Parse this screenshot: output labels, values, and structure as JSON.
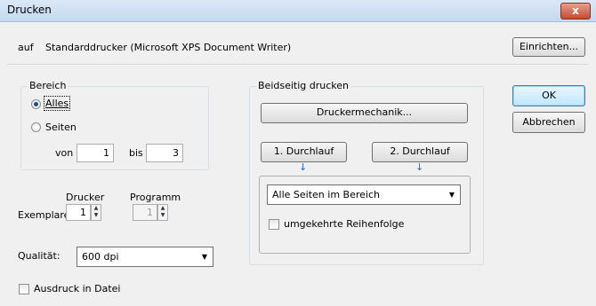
{
  "window": {
    "title": "Drucken",
    "close_glyph": "x"
  },
  "printer": {
    "prefix": "auf",
    "name": "Standarddrucker (Microsoft XPS Document Writer)",
    "setup_button": "Einrichten..."
  },
  "buttons": {
    "ok": "OK",
    "cancel": "Abbrechen"
  },
  "range": {
    "legend": "Bereich",
    "all_label": "Alles",
    "pages_label": "Seiten",
    "from_label": "von",
    "from_value": "1",
    "to_label": "bis",
    "to_value": "3",
    "selected": "all"
  },
  "copies": {
    "label": "Exemplare",
    "printer_header": "Drucker",
    "program_header": "Programm",
    "printer_value": "1",
    "program_value": "1"
  },
  "quality": {
    "label": "Qualität:",
    "value": "600 dpi"
  },
  "print_to_file": {
    "label": "Ausdruck in Datei",
    "checked": false
  },
  "duplex": {
    "legend": "Beidseitig drucken",
    "mechanics_button": "Druckermechanik...",
    "pass1_button": "1. Durchlauf",
    "pass2_button": "2. Durchlauf",
    "pages_select": "Alle Seiten im Bereich",
    "reverse_label": "umgekehrte Reihenfolge",
    "reverse_checked": false
  }
}
